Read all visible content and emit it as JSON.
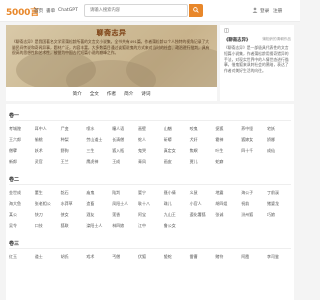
{
  "header": {
    "logo": "5000言",
    "nav": [
      "首页",
      "書单",
      "ChatGPT"
    ],
    "search_placeholder": "请输入搜索内容",
    "login": "登录",
    "register": "注册"
  },
  "book": {
    "title": "聊斋志异",
    "description": "《聊斋志异》是我国著名文学家蒲松龄所著的文言文小说集，全书共有491篇，作者蒲松龄以个人独特的视角记录了大量民间传说和奇闻异事，题材广泛，内容丰富，大多数篇目通过谈狐说鬼的方式来对当时的社会、政治进行批判，具有很高的思想性和艺术性，被誉为中国古代短篇小说的巅峰之作。",
    "tabs": [
      "简介",
      "全文",
      "作者",
      "简介",
      "诗词"
    ]
  },
  "side": {
    "label": "《聊斋志异》",
    "link": "蒲松龄的清朝作品",
    "text": "《聊斋志异》是一部极具代表性的文言短篇小说集，作者蒲松龄用搜奇猎异的手法，对现实世界中的人情世态进行描摹，借鬼狐来讽刺社会的黑暗，表达了作者对美好生活的向往。"
  },
  "chapters": [
    {
      "volume": "卷一",
      "rows": [
        [
          "考城隍",
          "耳中人",
          "尸变",
          "喷水",
          "瞳人语",
          "画壁",
          "山魈",
          "咬鬼",
          "捉狐",
          "荞中怪",
          "宅妖"
        ],
        [
          "王六郎",
          "偷桃",
          "种梨",
          "劳山道士",
          "长清僧",
          "蛇人",
          "斫蟒",
          "犬奸",
          "雹神",
          "狐嫁女",
          "娇娜"
        ],
        [
          "僧孽",
          "妖术",
          "野狗",
          "三生",
          "狐入瓶",
          "鬼哭",
          "真定女",
          "焦螟",
          "叶生",
          "四十千",
          "成仙"
        ],
        [
          "新郎",
          "灵官",
          "王兰",
          "鹰虎神",
          "王成",
          "青凤",
          "画皮",
          "贾儿",
          "蛇癖"
        ]
      ]
    },
    {
      "volume": "卷二",
      "rows": [
        [
          "金世成",
          "董生",
          "龁石",
          "庙鬼",
          "陆判",
          "婴宁",
          "聂小倩",
          "义鼠",
          "地震",
          "海公子",
          "丁前溪"
        ],
        [
          "海大鱼",
          "张老相公",
          "水莽草",
          "造畜",
          "凤阳士人",
          "耿十八",
          "珠儿",
          "小官人",
          "胡四姐",
          "祝翁",
          "猪婆龙"
        ],
        [
          "某公",
          "快刀",
          "侠女",
          "酒友",
          "莲香",
          "阿宝",
          "九山王",
          "遵化署狐",
          "张诚",
          "汾州狐",
          "巧娘"
        ],
        [
          "吴令",
          "口技",
          "狐联",
          "滦阳士人",
          "林四娘",
          "江中",
          "鲁公女"
        ]
      ]
    },
    {
      "volume": "卷三",
      "rows": [
        [
          "红玉",
          "道士",
          "胡氏",
          "戏术",
          "丐僧",
          "伏狐",
          "蛰蛇",
          "雷曹",
          "赌符",
          "阿霞",
          "李司鉴"
        ]
      ]
    }
  ]
}
